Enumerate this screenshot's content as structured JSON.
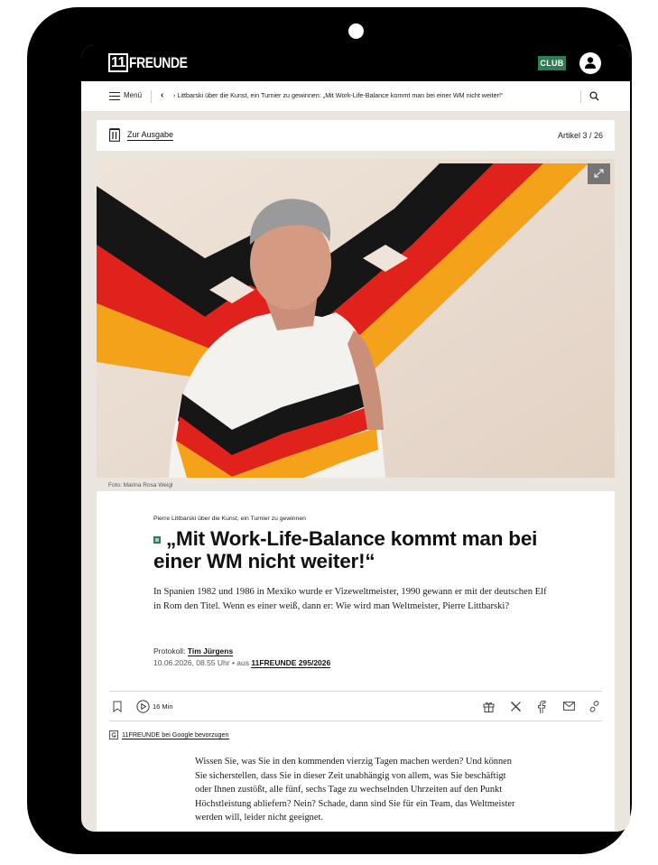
{
  "header": {
    "logo_number": "11",
    "logo_word": "FREUNDE",
    "club_label": "CLUB"
  },
  "nav": {
    "menu_label": "Menü",
    "ticker": "› Littbarski über die Kunst, ein Turnier zu gewinnen: „Mit Work-Life-Balance kommt man bei einer WM nicht weiter!“"
  },
  "issuebar": {
    "link_label": "Zur Ausgabe",
    "article_count": "Artikel 3 / 26"
  },
  "hero": {
    "caption": "Foto: Marina Rosa Weigl"
  },
  "article": {
    "kicker": "Pierre Littbarski über die Kunst, ein Turnier zu gewinnen",
    "headline": "„Mit Work-Life-Balance kommt man bei einer WM nicht weiter!“",
    "lead": "In Spanien 1982 und 1986 in Mexiko wurde er Vizeweltmeister, 1990 gewann er mit der deutschen Elf in Rom den Titel. Wenn es einer weiß, dann er: Wie wird man Weltmeister, Pierre Littbarski?",
    "byline_prefix": "Protokoll: ",
    "author": "Tim Jürgens",
    "date": "10.06.2026, 08.55 Uhr",
    "date_separator": " • aus ",
    "issue": "11FREUNDE 295/2026",
    "read_time": "16 Min",
    "google_pref": "11FREUNDE bei Google bevorzugen",
    "body": "Wissen Sie, was Sie in den kommenden vierzig Tagen machen werden? Und können Sie sicherstellen, dass Sie in dieser Zeit unabhängig von allem, was Sie beschäftigt oder Ihnen zustößt, alle fünf, sechs Tage zu wechselnden Uhrzeiten auf den Punkt Höchstleistung abliefern? Nein? Schade, dann sind Sie für ein Team, das Weltmeister werden will, leider nicht geeignet."
  },
  "colors": {
    "brand_green": "#2f7d54",
    "flag_black": "#161616",
    "flag_red": "#e1211c",
    "flag_gold": "#f5a21b"
  }
}
